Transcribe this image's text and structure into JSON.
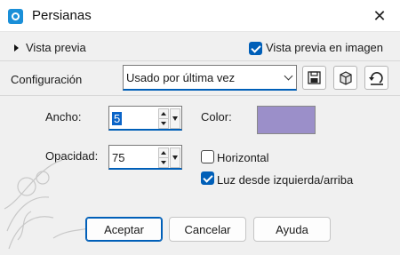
{
  "window": {
    "title": "Persianas",
    "close_glyph": "✕"
  },
  "preview": {
    "label": "Vista previa",
    "image_preview_label": "Vista previa en imagen",
    "image_preview_checked": true
  },
  "config": {
    "label": "Configuración",
    "preset_value": "Usado por última vez"
  },
  "toolbar": {
    "icons": [
      "save-icon",
      "cube-icon",
      "reset-icon"
    ]
  },
  "fields": {
    "width_label": "Ancho:",
    "width_value": "5",
    "opacity_label": "Opacidad:",
    "opacity_value": "75",
    "color_label": "Color:",
    "color_value": "#9b8fc9"
  },
  "options": {
    "horizontal_label": "Horizontal",
    "horizontal_checked": false,
    "light_label": "Luz desde izquierda/arriba",
    "light_checked": true
  },
  "buttons": {
    "accept": "Aceptar",
    "cancel": "Cancelar",
    "help": "Ayuda"
  },
  "accent": "#005fb8"
}
